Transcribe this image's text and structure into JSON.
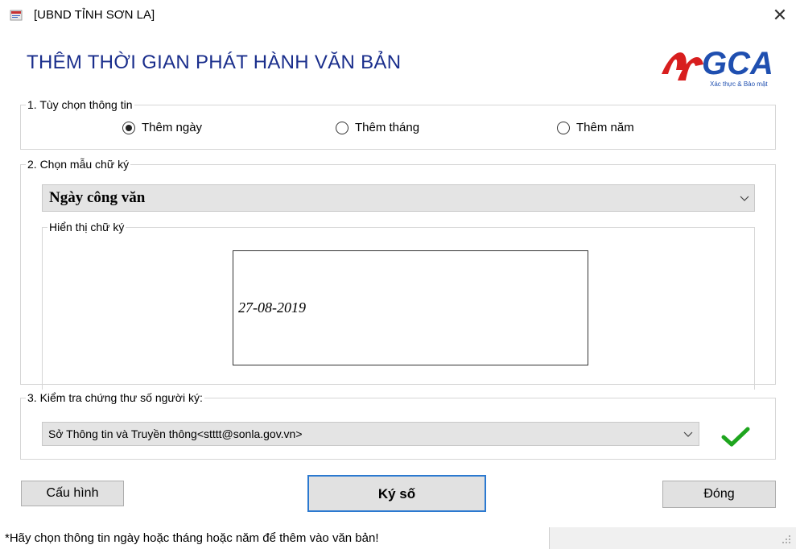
{
  "window": {
    "title": "[UBND TỈNH SƠN LA]",
    "close_glyph": "✕"
  },
  "header": {
    "title": "THÊM THỜI GIAN PHÁT HÀNH VĂN BẢN",
    "logo": {
      "wordmark": "GCA",
      "tagline": "Xác thực & Bảo mật",
      "colors": {
        "red": "#d81e1e",
        "blue": "#1f4fb0"
      }
    }
  },
  "options_group": {
    "legend": "1. Tùy chọn thông tin",
    "radios": [
      {
        "label": "Thêm ngày",
        "checked": true
      },
      {
        "label": "Thêm tháng",
        "checked": false
      },
      {
        "label": "Thêm năm",
        "checked": false
      }
    ]
  },
  "template_group": {
    "legend": "2. Chọn mẫu chữ ký",
    "selected": "Ngày công văn",
    "preview_legend": "Hiển thị chữ ký",
    "preview_value": "27-08-2019"
  },
  "cert_group": {
    "legend": "3. Kiểm tra chứng thư số người ký:",
    "selected": "Sở Thông tin và Truyền thông<stttt@sonla.gov.vn>",
    "check_icon": "check-icon",
    "check_color": "#1ea51e"
  },
  "buttons": {
    "config": "Cấu hình",
    "sign": "Ký số",
    "close": "Đóng"
  },
  "status": {
    "message": "*Hãy chọn thông tin ngày hoặc tháng hoặc năm để thêm vào văn bản!"
  }
}
